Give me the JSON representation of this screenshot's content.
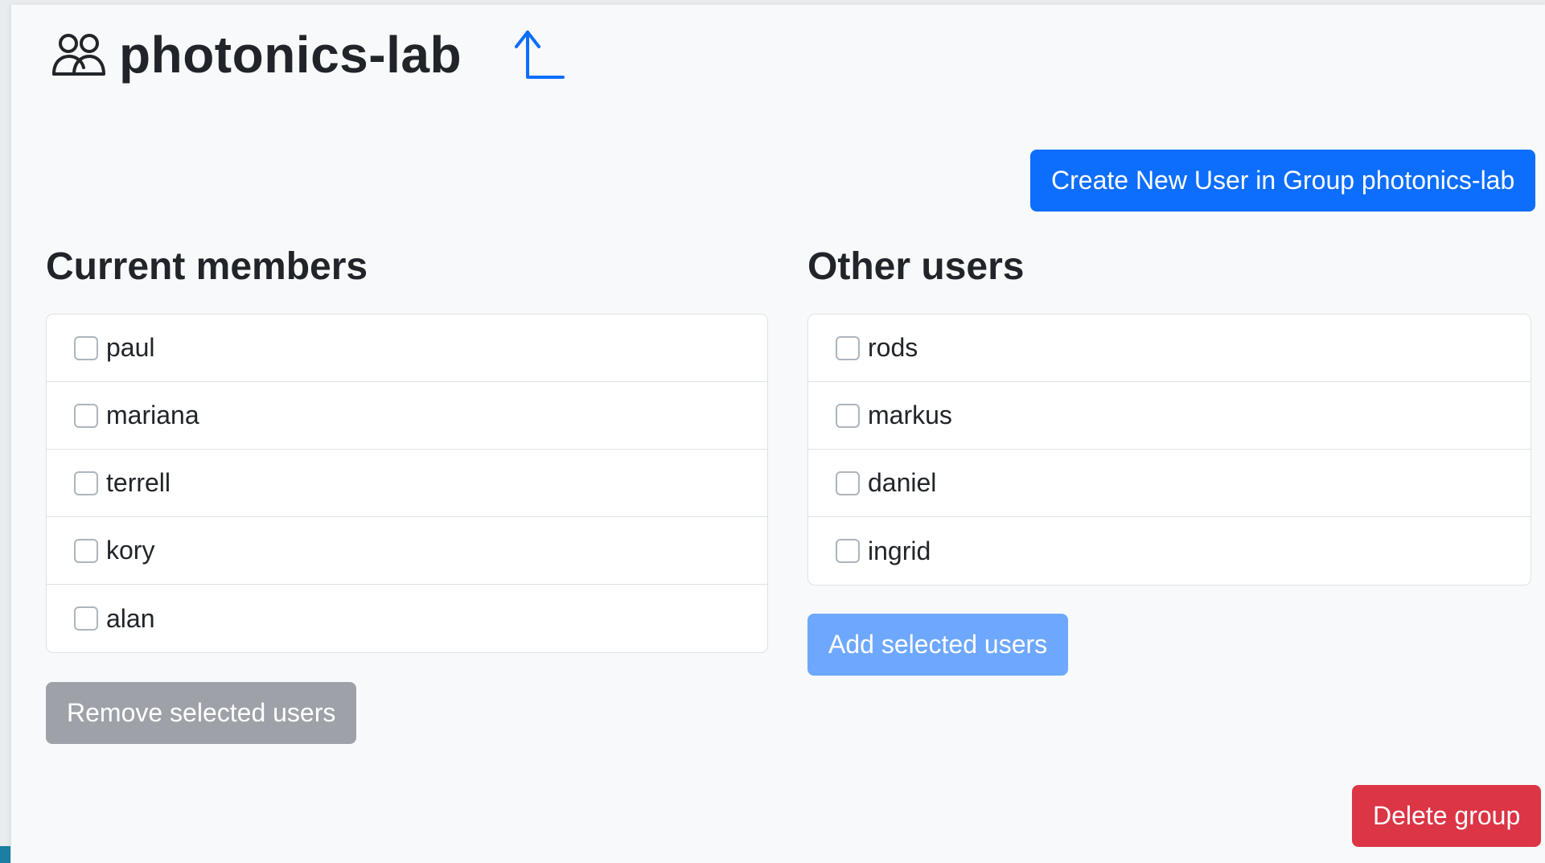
{
  "header": {
    "title": "photonics-lab",
    "group_icon": "people-icon",
    "up_icon": "arrow-up-icon"
  },
  "buttons": {
    "create_user": "Create New User in Group photonics-lab",
    "add_selected": "Add selected users",
    "remove_selected": "Remove selected users",
    "delete_group": "Delete group"
  },
  "current_members": {
    "heading": "Current members",
    "users": [
      "paul",
      "mariana",
      "terrell",
      "kory",
      "alan"
    ]
  },
  "other_users": {
    "heading": "Other users",
    "users": [
      "rods",
      "markus",
      "daniel",
      "ingrid"
    ]
  },
  "colors": {
    "primary": "#0d6efd",
    "primary_disabled": "#6ea8fe",
    "secondary_disabled": "#9ea2a8",
    "danger": "#dc3545"
  }
}
